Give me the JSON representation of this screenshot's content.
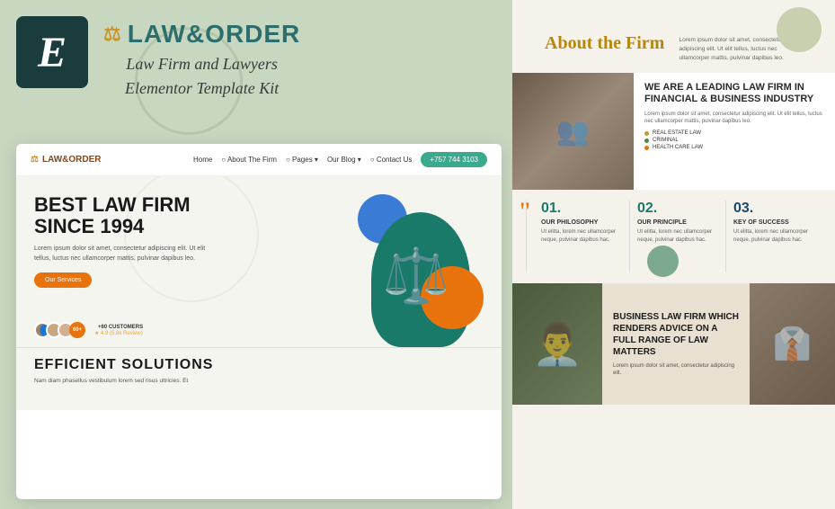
{
  "leftPanel": {
    "elementorLogo": "E",
    "brand": {
      "title": "LAW&ORDER",
      "subtitle1": "Law Firm and Lawyers",
      "subtitle2": "Elementor Template Kit"
    },
    "nav": {
      "logo": "LAW&ORDER",
      "links": [
        "Home",
        "About The Firm",
        "Pages",
        "Our Blog",
        "Contact Us"
      ],
      "cta": "+757 744 3103"
    },
    "hero": {
      "headline1": "BEST LAW FIRM",
      "headline2": "SINCE 1994",
      "body": "Lorem ipsum dolor sit amet, consectetur adipiscing elit. Ut elit tellus, luctus nec ullamcorper mattis, pulvinar dapibus leo.",
      "cta": "Our Services",
      "customersCount": "60+",
      "customersLabel": "+60 CUSTOMERS",
      "rating": "★ 4.9 (5.8k Review)"
    },
    "bottom": {
      "text": "EFFICIENT SOLUTIONS",
      "subtext": "Nam diam phasellus vestibulum lorem sed risus ultricies. Et"
    }
  },
  "rightPanel": {
    "about": {
      "heading": "About the Firm",
      "body": "Lorem ipsum dolor sit amet, consectetur adipiscing elit. Ut elit tellus, luctus nec ullamcorper mattis, pulvinar dapibus leo."
    },
    "leading": {
      "title": "WE ARE A LEADING LAW FIRM IN FINANCIAL & BUSINESS INDUSTRY",
      "body": "Lorem ipsum dolor sit amet, consectetur adipiscing elit. Ut elit tellus, luctus nec ullamcorper mattis, pulvinar dapibus leo.",
      "tags": [
        "REAL ESTATE LAW",
        "CRIMINAL",
        "HEALTH CARE LAW"
      ]
    },
    "philosophy": [
      {
        "number": "01.",
        "label": "OUR PHILOSOPHY",
        "body": "Ut elitta, lorem nec ullamcorper neque, pulvinar dapibus hac."
      },
      {
        "number": "02.",
        "label": "OUR PRINCIPLE",
        "body": "Ut elitta, lorem nec ullamcorper neque, pulvinar dapibus hac."
      },
      {
        "number": "03.",
        "label": "KEY OF SUCCESS",
        "body": "Ut elitta, lorem nec ullamcorper neque, pulvinar dapibus hac."
      }
    ],
    "bottom": {
      "title": "BUSINESS LAW FIRM WHICH RENDERS ADVICE ON A FULL RANGE OF LAW MATTERS",
      "body": "Lorem ipsum dolor sit amet, consectetur adipiscing elit."
    }
  }
}
